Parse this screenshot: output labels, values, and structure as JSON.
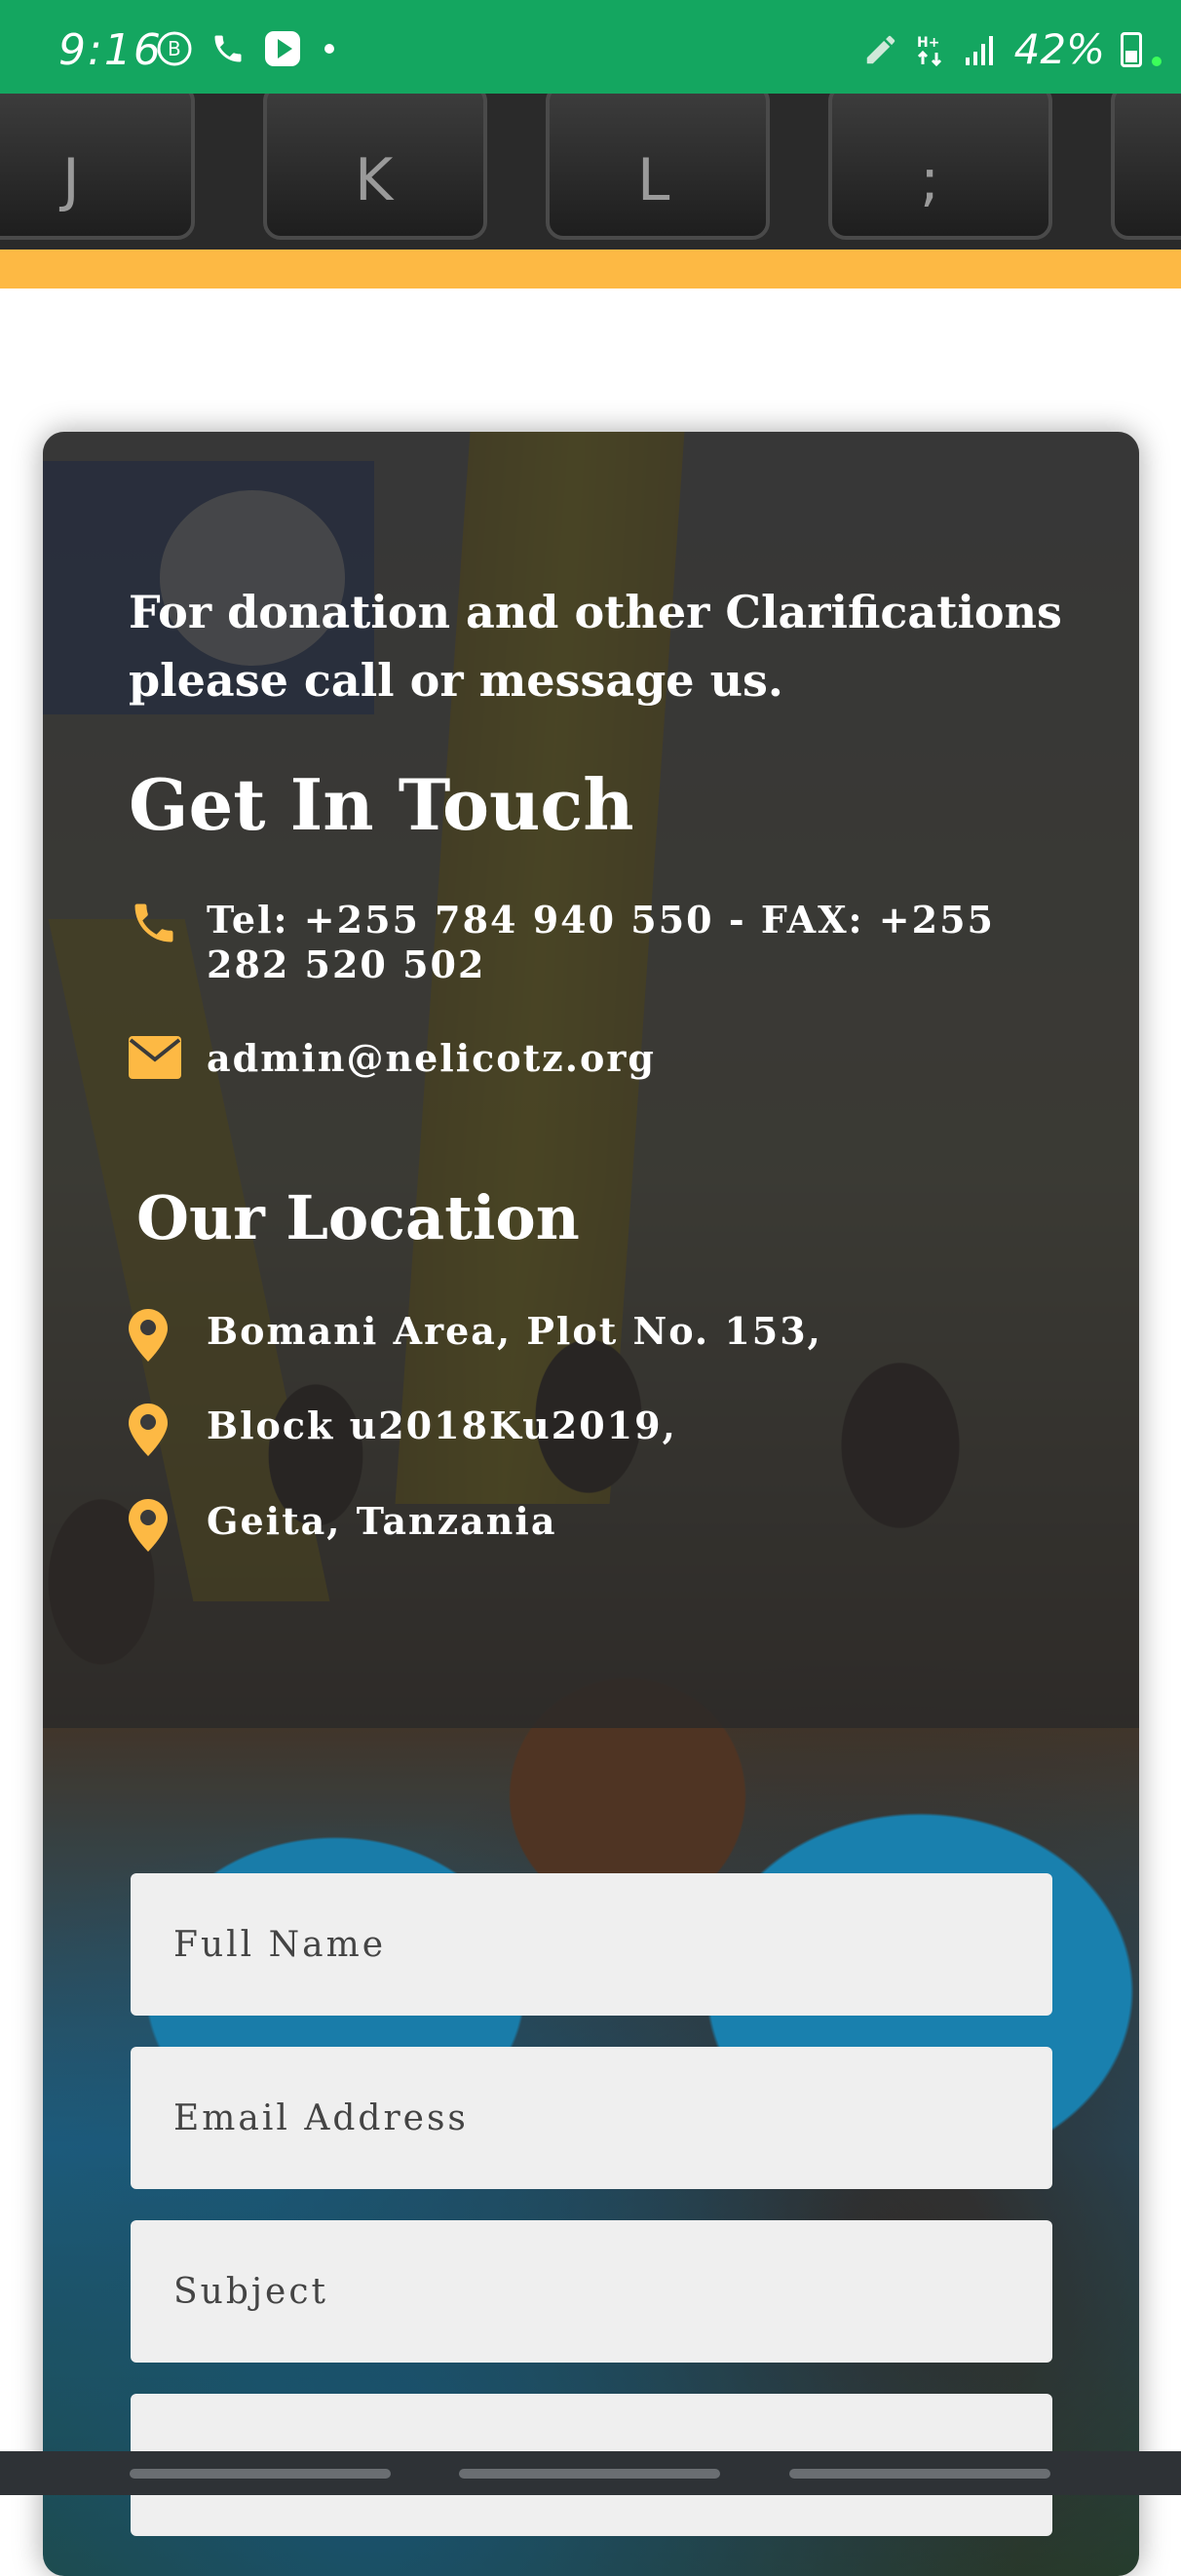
{
  "status_bar": {
    "time": "9:16",
    "battery": "42%",
    "bg_color": "#14a660"
  },
  "banner": {
    "keys": [
      "J",
      "K",
      "L",
      ";",
      "'"
    ],
    "stripe_color": "#fdb944"
  },
  "contact": {
    "intro": "For donation and other Clarifications please call or message us.",
    "heading": "Get In Touch",
    "phone": "Tel: +255 784 940 550 - FAX: +255 282 520 502",
    "email": "admin@nelicotz.org",
    "accent_color": "#fdb944"
  },
  "location": {
    "heading": "Our Location",
    "lines": [
      "Bomani Area, Plot No. 153,",
      "Block u2018Ku2019,",
      "Geita, Tanzania"
    ]
  },
  "form": {
    "full_name_placeholder": "Full Name",
    "email_placeholder": "Email Address",
    "subject_placeholder": "Subject"
  }
}
